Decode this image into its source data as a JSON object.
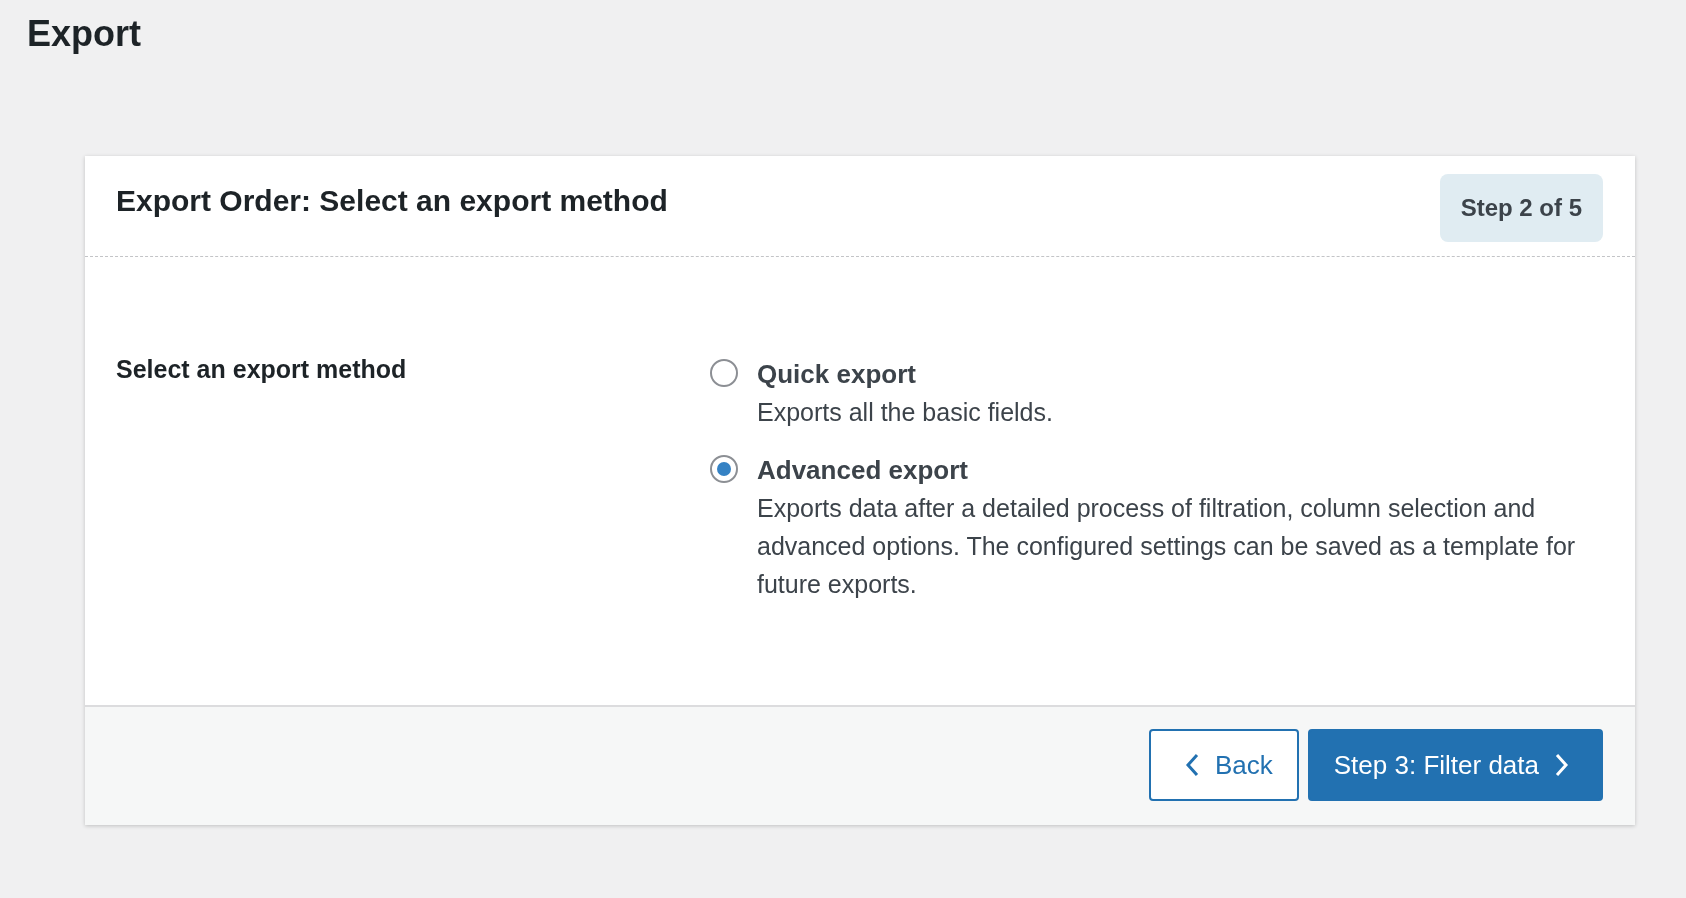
{
  "page": {
    "title": "Export"
  },
  "card": {
    "title": "Export Order: Select an export method",
    "step_badge": "Step 2 of 5",
    "field_label": "Select an export method",
    "options": [
      {
        "label": "Quick export",
        "description": "Exports all the basic fields.",
        "selected": false
      },
      {
        "label": "Advanced export",
        "description": "Exports data after a detailed process of filtration, column selection and advanced options. The configured settings can be saved as a template for future exports.",
        "selected": true
      }
    ],
    "buttons": {
      "back": "Back",
      "next": "Step 3: Filter data"
    }
  }
}
